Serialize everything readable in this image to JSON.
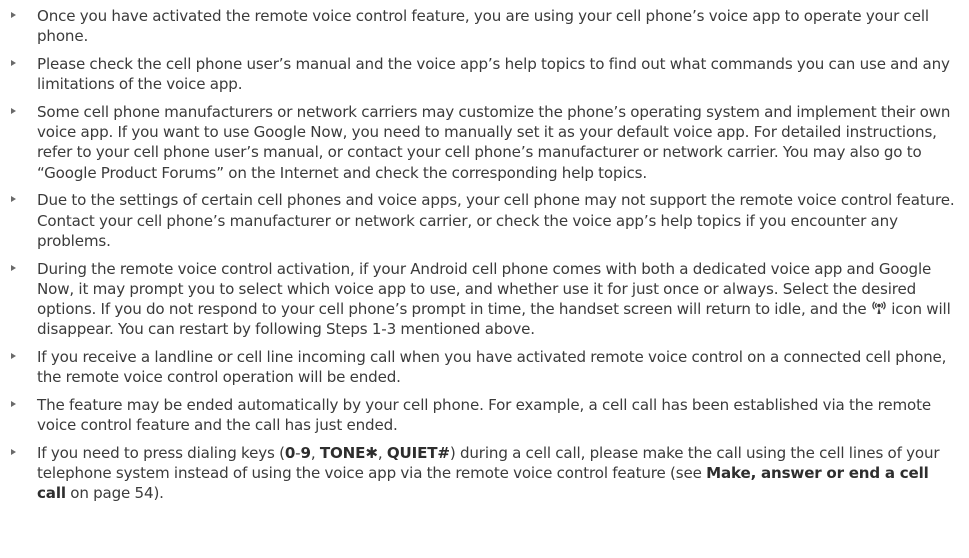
{
  "notes": [
    {
      "text": "Once you have activated the remote voice control feature, you are using your cell phone’s voice app to operate your cell phone."
    },
    {
      "text": "Please check the cell phone user’s manual and the voice app’s help topics to find out what commands you can use and any limitations of the voice app."
    },
    {
      "text": "Some cell phone manufacturers or network carriers may customize the phone’s operating system and implement their own voice app. If you want to use Google Now, you need to manually set it as your default voice app. For detailed instructions, refer to your cell phone user’s manual, or contact your cell phone’s manufacturer or network carrier. You may also go to “Google Product Forums” on the Internet and check the corresponding help topics."
    },
    {
      "text": "Due to the settings of certain cell phones and voice apps, your cell phone may not support the remote voice control feature. Contact your cell phone’s manufacturer or network carrier, or check the voice app’s help topics if you encounter any problems."
    },
    {
      "text_before_icon": "During the remote voice control activation, if your Android cell phone comes with both a dedicated voice app and Google Now, it may prompt you to select which voice app to use, and whether use it for just once or always. Select the desired options. If you do not respond to your cell phone’s prompt in time, the handset screen will return to idle, and the ",
      "icon": "remote-voice-control-icon",
      "text_after_icon": " icon will disappear. You can restart by following Steps 1-3 mentioned above."
    },
    {
      "text": "If you receive a landline or cell line incoming call when you have activated remote voice control on a connected cell phone, the remote voice control operation will be ended."
    },
    {
      "text": "The feature may be ended automatically by your cell phone. For example, a cell call has been established via the remote voice control feature and the call has just ended."
    },
    {
      "part1": "If you need to press dialing keys (",
      "key_digits": "0",
      "dash": "-",
      "key_digits_end": "9",
      "comma1": ", ",
      "key_tone": "TONE",
      "tone_symbol": "✱",
      "comma2": ", ",
      "key_quiet": "QUIET#",
      "part2": ") during a cell call, please make the call using the cell lines of your telephone system instead of using the voice app via the remote voice control feature (see ",
      "reference": "Make, answer or end a cell call",
      "part3": " on page 54)."
    }
  ],
  "colors": {
    "text": "#3b3b3b",
    "bullet": "#6a6a6a"
  }
}
